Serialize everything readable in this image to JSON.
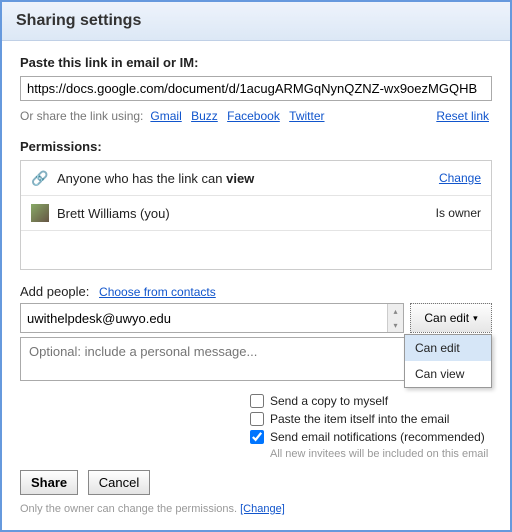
{
  "title": "Sharing settings",
  "paste_label": "Paste this link in email or IM:",
  "share_url": "https://docs.google.com/document/d/1acugARMGqNynQZNZ-wx9oezMGQHB",
  "share_using_label": "Or share the link using:",
  "share_links": {
    "gmail": "Gmail",
    "buzz": "Buzz",
    "facebook": "Facebook",
    "twitter": "Twitter"
  },
  "reset_link": "Reset link",
  "permissions_label": "Permissions:",
  "perm_link_text_pre": "Anyone who has the link can ",
  "perm_link_text_action": "view",
  "perm_change": "Change",
  "perm_user": "Brett Williams (you)",
  "perm_user_role": "Is owner",
  "add_people_label": "Add people:",
  "choose_contacts": "Choose from contacts",
  "add_email_value": "uwithelpdesk@uwyo.edu",
  "perm_button_label": "Can edit",
  "dropdown": {
    "edit": "Can edit",
    "view": "Can view"
  },
  "message_placeholder": "Optional: include a personal message...",
  "checks": {
    "copy_self": "Send a copy to myself",
    "paste_item": "Paste the item itself into the email",
    "notify": "Send email notifications (recommended)"
  },
  "fine_print": "All new invitees will be included on this email",
  "share_btn": "Share",
  "cancel_btn": "Cancel",
  "footer_text": "Only the owner can change the permissions.  ",
  "footer_change": "[Change]"
}
